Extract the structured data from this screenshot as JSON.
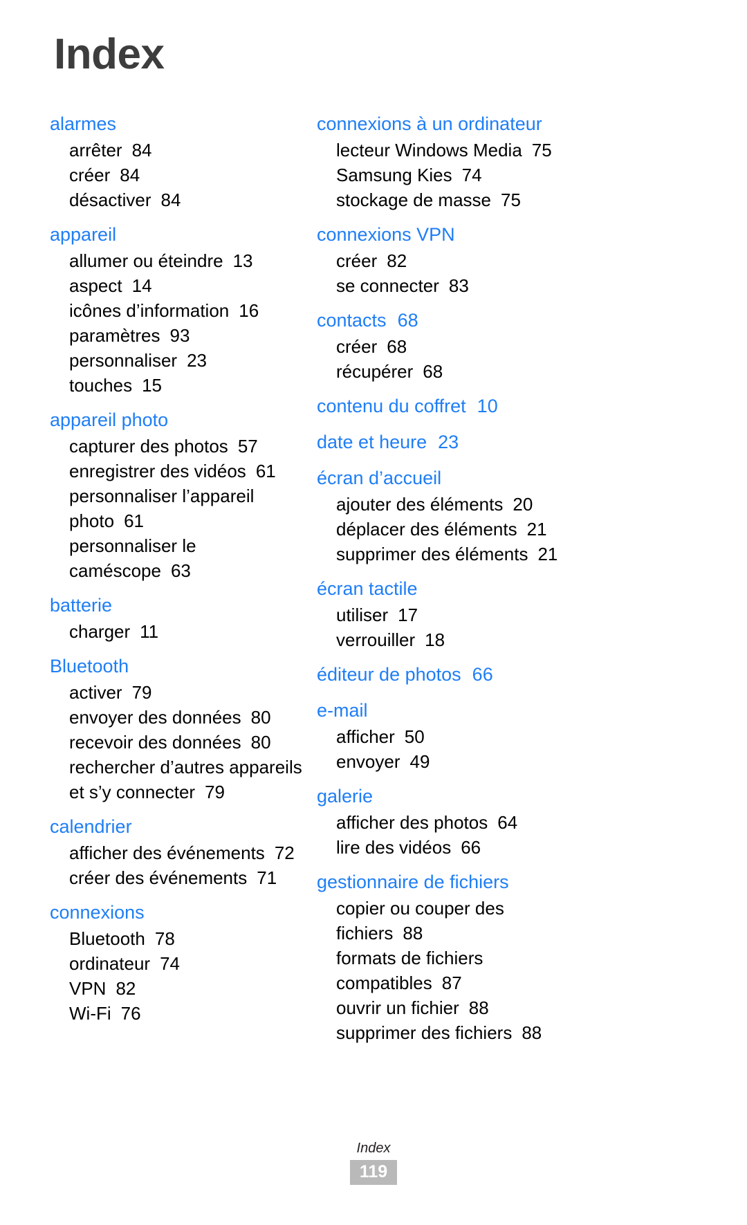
{
  "page": {
    "title": "Index",
    "footer_label": "Index",
    "footer_page_number": "119",
    "heading_color": "#1f7ef5",
    "title_color": "#3d3d3d",
    "badge_color": "#b9b9b9"
  },
  "columns": [
    {
      "name": "left-column",
      "groups": [
        {
          "heading": "alarmes",
          "heading_page": "",
          "items": [
            {
              "label": "arrêter",
              "page": "84"
            },
            {
              "label": "créer",
              "page": "84"
            },
            {
              "label": "désactiver",
              "page": "84"
            }
          ]
        },
        {
          "heading": "appareil",
          "heading_page": "",
          "items": [
            {
              "label": "allumer ou éteindre",
              "page": "13"
            },
            {
              "label": "aspect",
              "page": "14"
            },
            {
              "label": "icônes d’information",
              "page": "16"
            },
            {
              "label": "paramètres",
              "page": "93"
            },
            {
              "label": "personnaliser",
              "page": "23"
            },
            {
              "label": "touches",
              "page": "15"
            }
          ]
        },
        {
          "heading": "appareil photo",
          "heading_page": "",
          "items": [
            {
              "label": "capturer des photos",
              "page": "57"
            },
            {
              "label": "enregistrer des vidéos",
              "page": "61"
            },
            {
              "label": "personnaliser l’appareil",
              "page": ""
            },
            {
              "label": "photo",
              "page": "61"
            },
            {
              "label": "personnaliser le",
              "page": ""
            },
            {
              "label": "caméscope",
              "page": "63"
            }
          ]
        },
        {
          "heading": "batterie",
          "heading_page": "",
          "items": [
            {
              "label": "charger",
              "page": "11"
            }
          ]
        },
        {
          "heading": "Bluetooth",
          "heading_page": "",
          "items": [
            {
              "label": "activer",
              "page": "79"
            },
            {
              "label": "envoyer des données",
              "page": "80"
            },
            {
              "label": "recevoir des données",
              "page": "80"
            },
            {
              "label": "rechercher d’autres appareils",
              "page": ""
            },
            {
              "label": "et s’y connecter",
              "page": "79"
            }
          ]
        },
        {
          "heading": "calendrier",
          "heading_page": "",
          "items": [
            {
              "label": "afficher des événements",
              "page": "72"
            },
            {
              "label": "créer des événements",
              "page": "71"
            }
          ]
        },
        {
          "heading": "connexions",
          "heading_page": "",
          "items": [
            {
              "label": "Bluetooth",
              "page": "78"
            },
            {
              "label": "ordinateur",
              "page": "74"
            },
            {
              "label": "VPN",
              "page": "82"
            },
            {
              "label": "Wi-Fi",
              "page": "76"
            }
          ]
        }
      ]
    },
    {
      "name": "right-column",
      "groups": [
        {
          "heading": "connexions à un ordinateur",
          "heading_page": "",
          "items": [
            {
              "label": "lecteur Windows Media",
              "page": "75"
            },
            {
              "label": "Samsung Kies",
              "page": "74"
            },
            {
              "label": "stockage de masse",
              "page": "75"
            }
          ]
        },
        {
          "heading": "connexions VPN",
          "heading_page": "",
          "items": [
            {
              "label": "créer",
              "page": "82"
            },
            {
              "label": "se connecter",
              "page": "83"
            }
          ]
        },
        {
          "heading": "contacts",
          "heading_page": "68",
          "items": [
            {
              "label": "créer",
              "page": "68"
            },
            {
              "label": "récupérer",
              "page": "68"
            }
          ]
        },
        {
          "heading": "contenu du coffret",
          "heading_page": "10",
          "items": []
        },
        {
          "heading": "date et heure",
          "heading_page": "23",
          "items": []
        },
        {
          "heading": "écran d’accueil",
          "heading_page": "",
          "items": [
            {
              "label": "ajouter des éléments",
              "page": "20"
            },
            {
              "label": "déplacer des éléments",
              "page": "21"
            },
            {
              "label": "supprimer des éléments",
              "page": "21"
            }
          ]
        },
        {
          "heading": "écran tactile",
          "heading_page": "",
          "items": [
            {
              "label": "utiliser",
              "page": "17"
            },
            {
              "label": "verrouiller",
              "page": "18"
            }
          ]
        },
        {
          "heading": "éditeur de photos",
          "heading_page": "66",
          "items": []
        },
        {
          "heading": "e-mail",
          "heading_page": "",
          "items": [
            {
              "label": "afficher",
              "page": "50"
            },
            {
              "label": "envoyer",
              "page": "49"
            }
          ]
        },
        {
          "heading": "galerie",
          "heading_page": "",
          "items": [
            {
              "label": "afficher des photos",
              "page": "64"
            },
            {
              "label": "lire des vidéos",
              "page": "66"
            }
          ]
        },
        {
          "heading": "gestionnaire de fichiers",
          "heading_page": "",
          "items": [
            {
              "label": "copier ou couper des",
              "page": ""
            },
            {
              "label": "fichiers",
              "page": "88"
            },
            {
              "label": "formats de fichiers",
              "page": ""
            },
            {
              "label": "compatibles",
              "page": "87"
            },
            {
              "label": "ouvrir un fichier",
              "page": "88"
            },
            {
              "label": "supprimer des fichiers",
              "page": "88"
            }
          ]
        }
      ]
    }
  ]
}
